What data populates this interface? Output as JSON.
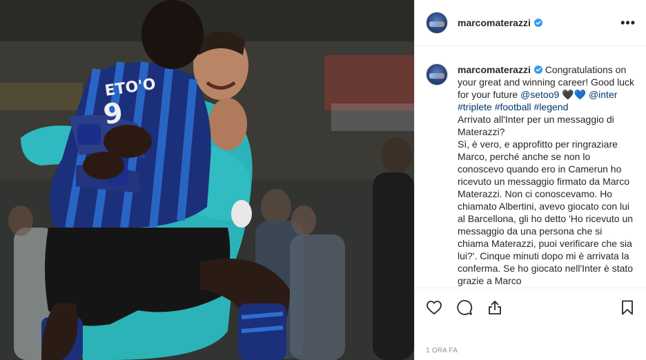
{
  "post": {
    "image_alt": "Two Inter players embracing on the pitch",
    "jersey_text": "ETO'O"
  },
  "header": {
    "username": "marcomaterazzi",
    "verified_icon": "verified-badge-icon",
    "more_icon": "more-options-icon",
    "more_label": "•••"
  },
  "caption": {
    "username": "marcomaterazzi",
    "text_1": "Congratulations on your great and winning career! Good luck for your future",
    "mention": "@setoo9",
    "emoji": "🖤💙",
    "hashtags": [
      "@inter",
      "#triplete",
      "#football",
      "#legend"
    ],
    "para_1": "Arrivato all'Inter per un messaggio di Materazzi?",
    "para_2": "Sì, è vero, e approfitto per ringraziare Marco, perché anche se non lo conoscevo quando ero in Camerun ho ricevuto un messaggio firmato da Marco Materazzi. Non ci conoscevamo. Ho chiamato Albertini, avevo giocato con lui al Barcellona, gli ho detto 'Ho ricevuto un messaggio da una persona che si chiama Materazzi, puoi verificare che sia lui?'. Cinque minuti dopo mi è arrivata la conferma. Se ho giocato nell'Inter è stato grazie a Marco"
  },
  "actions": {
    "like_icon": "heart-icon",
    "comment_icon": "comment-icon",
    "share_icon": "share-icon",
    "save_icon": "bookmark-icon"
  },
  "timestamp": "1 ORA FA",
  "colors": {
    "link": "#00376b",
    "verified": "#3897f0",
    "text": "#262626",
    "muted": "#8e8e8e",
    "border": "#efefef"
  }
}
